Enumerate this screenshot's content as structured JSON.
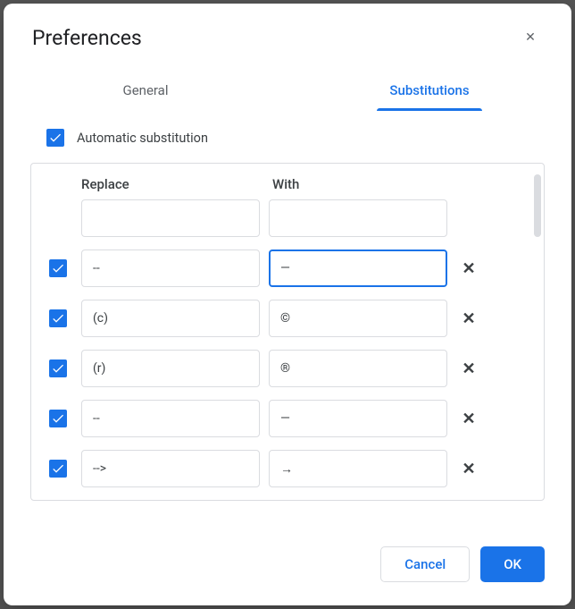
{
  "dialog": {
    "title": "Preferences"
  },
  "tabs": {
    "general": "General",
    "substitutions": "Substitutions",
    "active": "substitutions"
  },
  "auto_sub": {
    "label": "Automatic substitution",
    "checked": true
  },
  "columns": {
    "replace": "Replace",
    "with": "With"
  },
  "rows": [
    {
      "checked": null,
      "replace": "",
      "with": "",
      "deletable": false,
      "focused": false
    },
    {
      "checked": true,
      "replace": "--",
      "with": "—",
      "deletable": true,
      "focused": true
    },
    {
      "checked": true,
      "replace": "(c)",
      "with": "©",
      "deletable": true,
      "focused": false
    },
    {
      "checked": true,
      "replace": "(r)",
      "with": "®",
      "deletable": true,
      "focused": false
    },
    {
      "checked": true,
      "replace": "--",
      "with": "—",
      "deletable": true,
      "focused": false
    },
    {
      "checked": true,
      "replace": "-->",
      "with": "→",
      "deletable": true,
      "focused": false
    }
  ],
  "buttons": {
    "cancel": "Cancel",
    "ok": "OK"
  },
  "glyphs": {
    "close": "✕",
    "delete": "✕"
  }
}
